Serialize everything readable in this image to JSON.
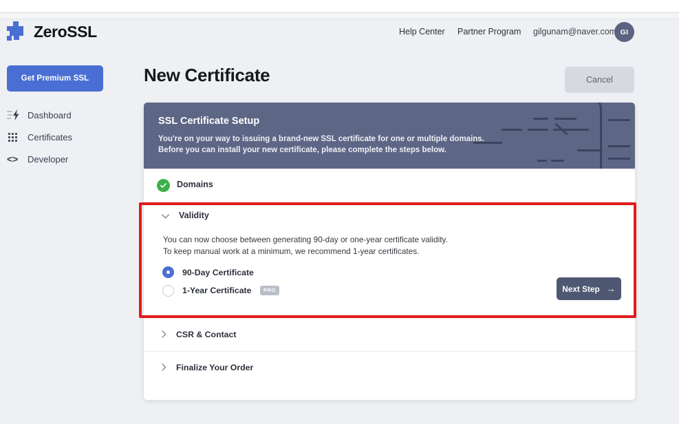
{
  "brand": {
    "name": "ZeroSSL",
    "logo_icon": "puzzle-piece-icon",
    "accent_color": "#4a6fd4"
  },
  "topnav": {
    "links": [
      {
        "label": "Help Center",
        "name": "help-center"
      },
      {
        "label": "Partner Program",
        "name": "partner-program"
      }
    ],
    "account_email": "gilgunam@naver.com",
    "avatar_initials": "GI"
  },
  "sidebar": {
    "premium_button": "Get Premium SSL",
    "items": [
      {
        "label": "Dashboard",
        "icon": "lightning-bolt-icon"
      },
      {
        "label": "Certificates",
        "icon": "grid-dots-icon"
      },
      {
        "label": "Developer",
        "icon": "code-brackets-icon"
      }
    ]
  },
  "main": {
    "title": "New Certificate",
    "cancel_label": "Cancel"
  },
  "banner": {
    "title": "SSL Certificate Setup",
    "line1": "You're on your way to issuing a brand-new SSL certificate for one or multiple domains.",
    "line2": "Before you can install your new certificate, please complete the steps below.",
    "background_color": "#5d6685"
  },
  "steps": {
    "domains": {
      "label": "Domains",
      "status": "complete",
      "status_color": "#3cb14a"
    },
    "validity": {
      "label": "Validity",
      "expanded": true,
      "desc_line1": "You can now choose between generating 90-day or one-year certificate validity.",
      "desc_line2": "To keep manual work at a minimum, we recommend 1-year certificates.",
      "options": [
        {
          "label": "90-Day Certificate",
          "selected": true,
          "badge": ""
        },
        {
          "label": "1-Year Certificate",
          "selected": false,
          "badge": "PRO"
        }
      ],
      "next_button": "Next Step",
      "next_arrow": "→"
    },
    "csr": {
      "label": "CSR & Contact",
      "expanded": false
    },
    "finalize": {
      "label": "Finalize Your Order",
      "expanded": false
    }
  },
  "annotation": {
    "highlight_color": "#e01b1b",
    "target": "validity-section"
  },
  "glyphs": {
    "chevron_down": "⌄",
    "chevron_right": "›",
    "code": "<>"
  }
}
